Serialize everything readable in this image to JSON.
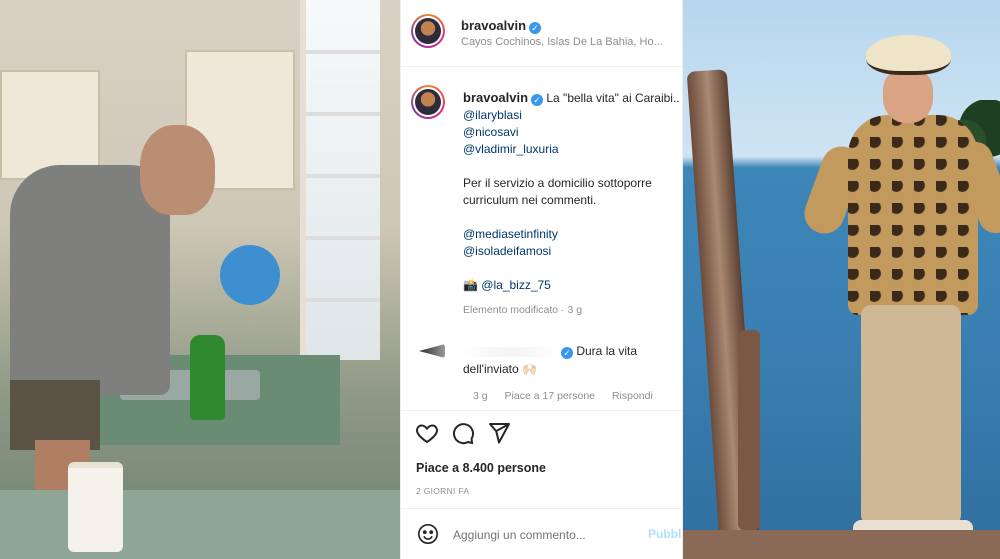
{
  "post": {
    "username": "bravoalvin",
    "location": "Cayos Cochinos, Islas De La Bahia, Ho...",
    "caption_first_line": "La \"bella vita\" ai Caraibi..",
    "mentions_1": [
      "@ilaryblasi",
      "@nicosavi",
      "@vladimir_luxuria"
    ],
    "caption_body_1": "Per il servizio a domicilio sottoporre",
    "caption_body_2": "curriculum nei commenti.",
    "mentions_2": [
      "@mediasetinfinity",
      "@isoladeifamosi"
    ],
    "camera_emoji": "📸",
    "credit": "@la_bizz_75",
    "edited_meta": "Elemento modificato · 3 g"
  },
  "comment": {
    "text_1": "Dura la vita",
    "text_2": "dell'inviato 🙌🏻",
    "time": "3 g",
    "likes": "Piace a 17 persone",
    "reply": "Rispondi"
  },
  "actions": {
    "like_icon": "heart-icon",
    "comment_icon": "comment-icon",
    "share_icon": "send-icon"
  },
  "likes_text": "Piace a 8.400 persone",
  "time_ago": "2 GIORNI FA",
  "add_comment": {
    "placeholder": "Aggiungi un commento...",
    "publish_label": "Pubblica"
  },
  "colors": {
    "accent": "#0095f6",
    "mention": "#00376b",
    "muted": "#8e8e8e"
  }
}
